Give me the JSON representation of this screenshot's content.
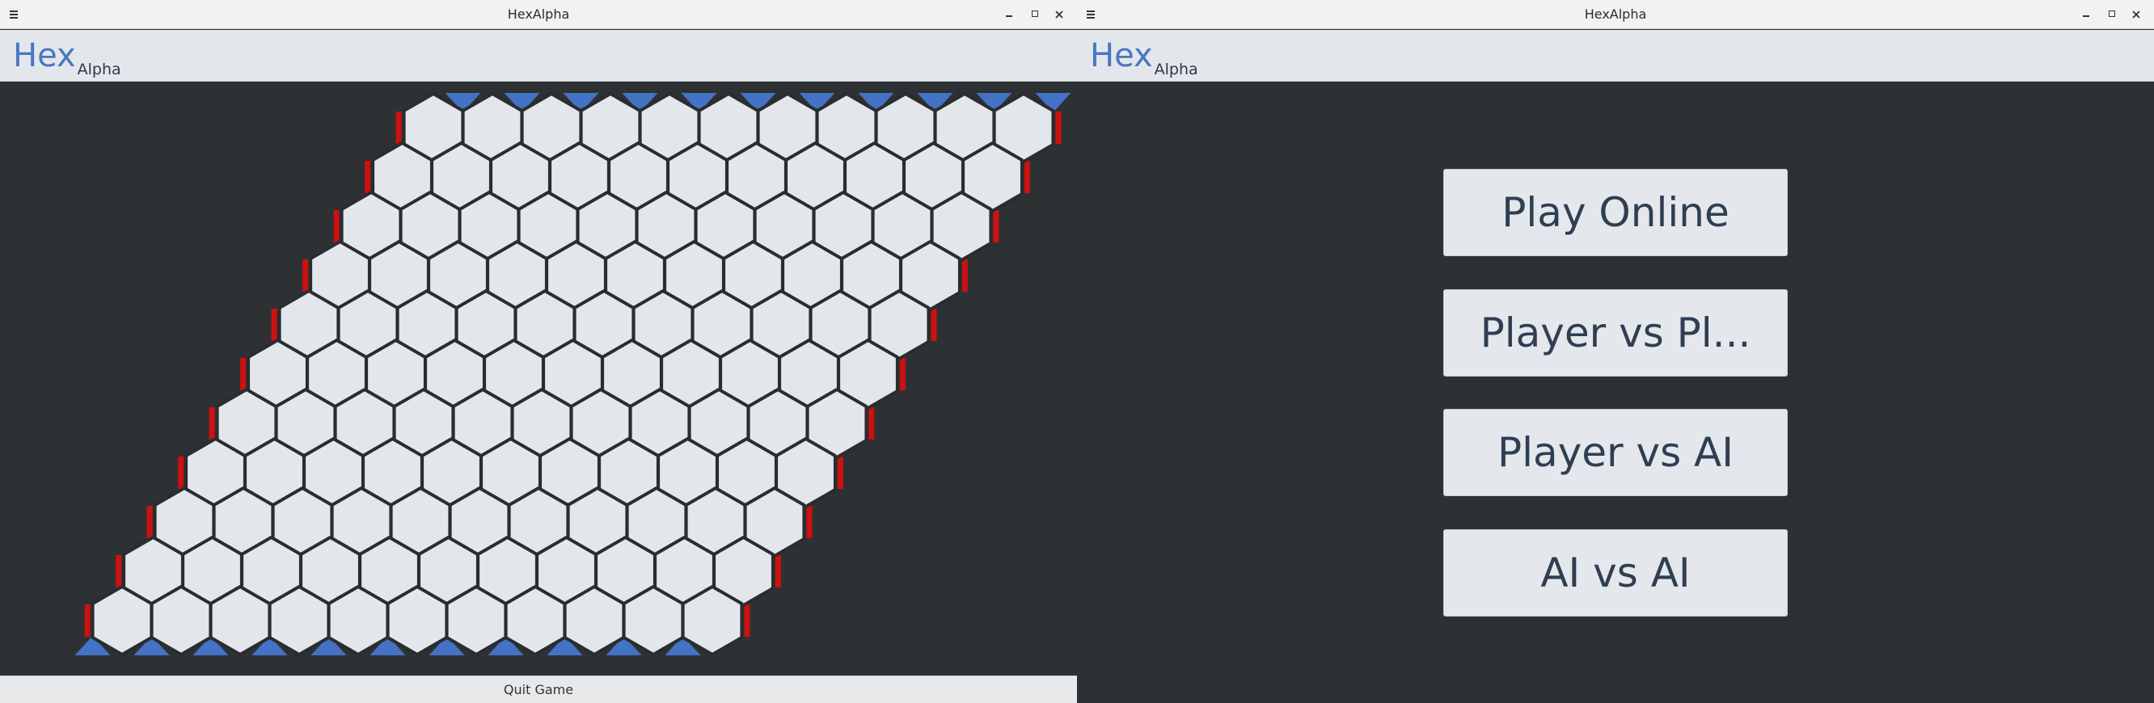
{
  "windows": [
    {
      "title": "HexAlpha",
      "logo": {
        "main": "Hex",
        "sub": "Alpha"
      },
      "footer": {
        "quit_label": "Quit Game"
      }
    },
    {
      "title": "HexAlpha",
      "logo": {
        "main": "Hex",
        "sub": "Alpha"
      },
      "menu": {
        "play_online": "Play Online",
        "player_vs_player": "Player vs Pl...",
        "player_vs_ai": "Player vs AI",
        "ai_vs_ai": "AI vs AI"
      }
    }
  ],
  "board": {
    "size": 11,
    "cells": "all-empty",
    "edge_colors": {
      "top_bottom": "#4472c4",
      "left_right": "#cc1111"
    },
    "cell_fill": "#e3e7eb",
    "cell_stroke": "#2a2d30"
  },
  "colors": {
    "background": "#2e3133",
    "header": "#e3e7eb",
    "logo_accent": "#4a77c0",
    "button_text": "#2f3e52"
  },
  "icons": {
    "menu": "hamburger-icon",
    "minimize": "minimize-icon",
    "maximize": "maximize-icon",
    "close": "close-icon"
  }
}
